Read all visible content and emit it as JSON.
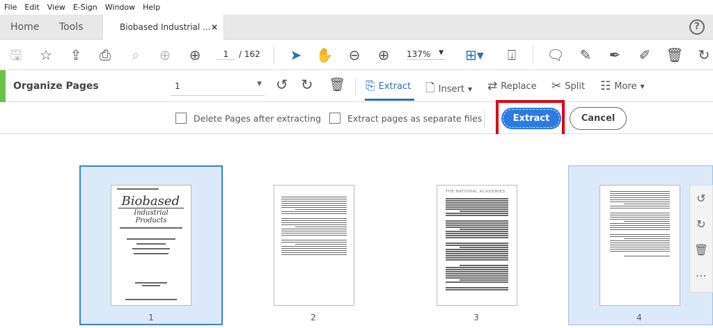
{
  "menu": [
    "File",
    "Edit",
    "View",
    "E-Sign",
    "Window",
    "Help"
  ],
  "tabs": {
    "home": "Home",
    "tools": "Tools",
    "document": "Biobased Industrial ...",
    "close": "×",
    "help": "?"
  },
  "toolbar": {
    "current_page": "1",
    "total_pages": "/ 162",
    "zoom": "137%"
  },
  "organize": {
    "title": "Organize Pages",
    "page_range": "1",
    "extract": "Extract",
    "insert": "Insert",
    "replace": "Replace",
    "split": "Split",
    "more": "More"
  },
  "options": {
    "delete_after": "Delete Pages after extracting",
    "separate_files": "Extract pages as separate files",
    "delete_after_checked": false,
    "separate_files_checked": false,
    "extract_button": "Extract",
    "cancel_button": "Cancel"
  },
  "highlight_color": "#e00012",
  "accent_color": "#2c7be0",
  "pages": [
    {
      "number": "1",
      "selected": true,
      "title_line1": "Biobased",
      "title_line2": "Industrial Products"
    },
    {
      "number": "2",
      "selected": false
    },
    {
      "number": "3",
      "selected": false,
      "heading": "THE NATIONAL ACADEMIES"
    },
    {
      "number": "4",
      "selected": true
    }
  ]
}
